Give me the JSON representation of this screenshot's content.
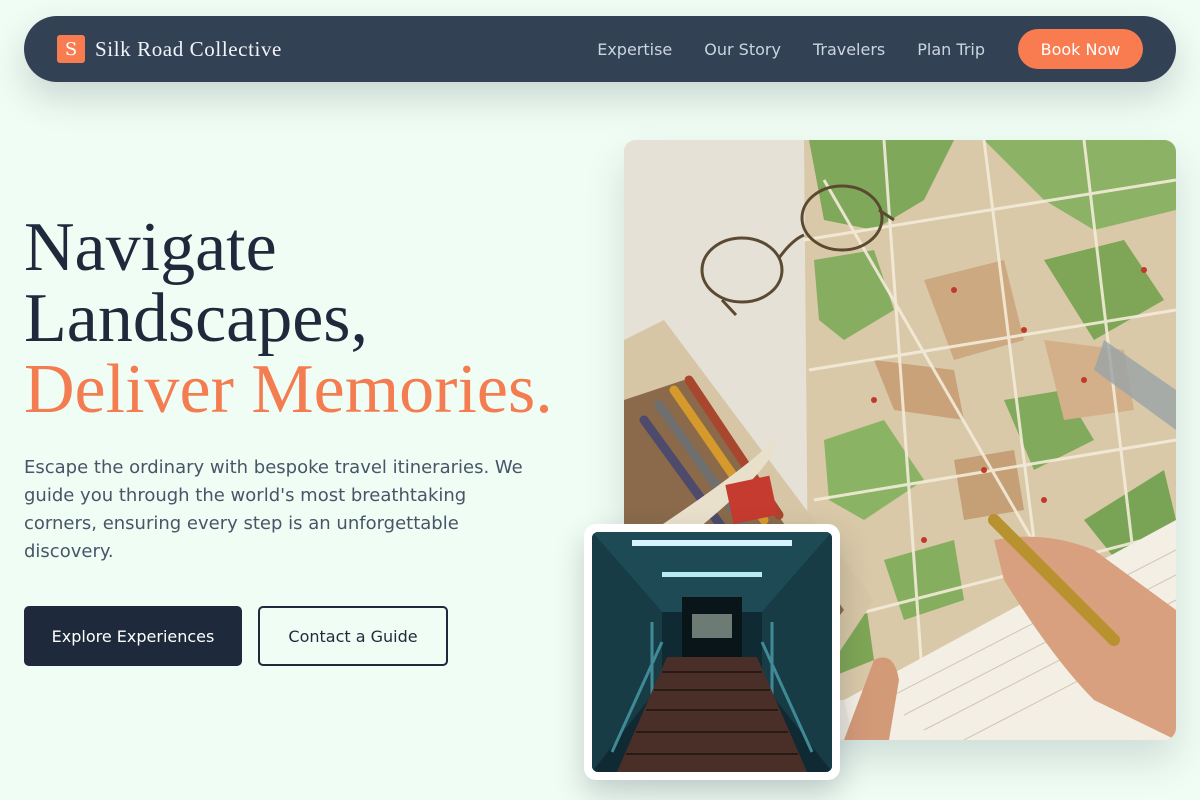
{
  "brand": {
    "initial": "S",
    "name": "Silk Road Collective"
  },
  "nav": {
    "links": [
      "Expertise",
      "Our Story",
      "Travelers",
      "Plan Trip"
    ],
    "cta": "Book Now"
  },
  "hero": {
    "title_line1": "Navigate",
    "title_line2": "Landscapes,",
    "title_accent": "Deliver Memories.",
    "description": "Escape the ordinary with bespoke travel itineraries. We guide you through the world's most breathtaking corners, ensuring every step is an unforgettable discovery.",
    "primary_button": "Explore Experiences",
    "secondary_button": "Contact a Guide"
  },
  "images": {
    "main_icon": "map-planning-photo",
    "inset_icon": "stairway-corridor-photo"
  },
  "colors": {
    "background": "#f0fdf4",
    "navbar": "#334155",
    "accent": "#f47c51",
    "dark": "#1e293b",
    "body_text": "#475569"
  }
}
